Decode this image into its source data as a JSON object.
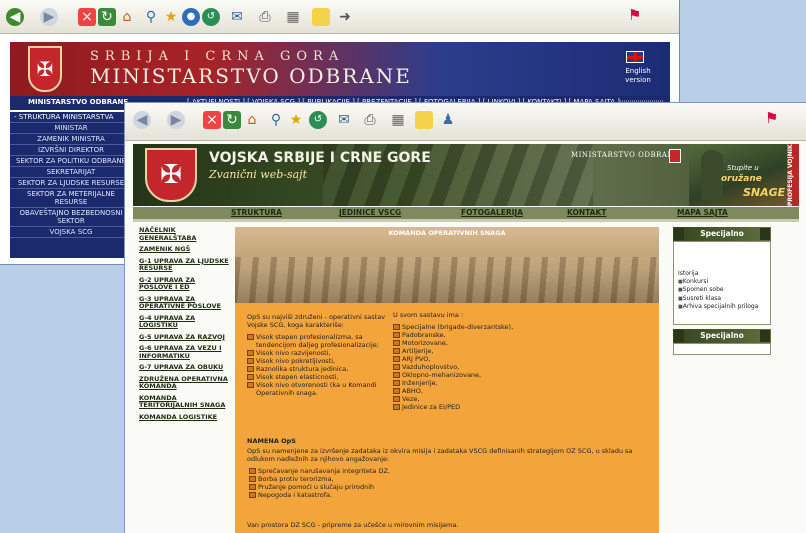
{
  "back_window": {
    "toolbar_icons": [
      "back-icon",
      "forward-icon",
      "stop-icon",
      "refresh-icon",
      "home-icon",
      "search-icon",
      "favorites-icon",
      "media-icon",
      "history-icon",
      "mail-icon",
      "print-icon",
      "edit-icon",
      "folder-icon",
      "messenger-icon"
    ],
    "banner": {
      "line1": "SRBIJA I CRNA GORA",
      "line2": "MINISTARSTVO ODBRANE",
      "english_link": "English version"
    },
    "label_bar": {
      "left": "MINISTARSTVO ODBRANE",
      "links": "[ AKTUELNOSTI ] [ VOJSKA SCG ] [ PUBLIKACIJE ] [ PREZENTACIJE ] [ FOTOGALERIJA ] [ LINKOVI ] [ KONTAKTI ] [ MAPA SAJTA ]"
    },
    "menu": [
      "- STRUKTURA MINISTARSTVA",
      "MINISTAR",
      "ZAMENIK MINISTRA",
      "IZVRŠNI DIREKTOR",
      "SEKTOR ZA POLITIKU ODBRANE",
      "SEKRETARIJAT",
      "SEKTOR ZA LJUDSKE RESURSE",
      "SEKTOR ZA METERIJALNE RESURSE",
      "OBAVEŠTAJNO BEZBEDNOSNI SEKTOR",
      "VOJSKA SCG"
    ]
  },
  "front_window": {
    "header": {
      "title": "VOJSKA SRBIJE I CRNE GORE",
      "subtitle": "Zvanični web-sajt",
      "ministry": "MINISTARSTVO ODBRANE",
      "promo": {
        "line1": "Stupite u",
        "line2": "oružane",
        "line3": "SNAGE",
        "vertical": "PROFESIJA VOJNIK"
      }
    },
    "nav": [
      "STRUKTURA",
      "JEDINICE VSCG",
      "FOTOGALERIJA",
      "KONTAKT",
      "MAPA SAJTA"
    ],
    "left_links": [
      "NAČELNIK GENERALŠTABA",
      "ZAMENIK NGŠ",
      "G-1 UPRAVA ZA LJUDSKE RESURSE",
      "G-2 UPRAVA ZA POSLOVE I ED",
      "G-3 UPRAVA ZA OPERATIVNE POSLOVE",
      "G-4 UPRAVA ZA LOGISTIKU",
      "G-5 UPRAVA ZA RAZVOJ",
      "G-6 UPRAVA ZA VEZU I INFORMATIKU",
      "G-7 UPRAVA ZA OBUKU",
      "ZDRUŽENA OPERATIVNA KOMANDA",
      "KOMANDA TERITORIJALNIH SNAGA",
      "KOMANDA LOGISTIKE"
    ],
    "main": {
      "photo_caption": "KOMANDA OPERATIVNIH SNAGA",
      "col1_intro": "OpS su najviši združeni - operativni sastav Vojske SCG, koga karakteriše:",
      "col1_items": [
        "Visok stepen profesionalizma, sa tendencijom daljeg profesionalizacije;",
        "Visok nivo razvijenosti,",
        "Visok nivo pokretljivosti,",
        "Raznolika struktura jedinica,",
        "Visok stepen elasticnosti,",
        "Visok nivo otvorenosti (ka u Komandi Operativnih snaga."
      ],
      "col2_intro": "U svom sastavu ima :",
      "col2_items": [
        "Specijalne (brigade-diverzantske),",
        "Padobranske,",
        "Motorizovane,",
        "Artiljerije,",
        "ARJ PVO,",
        "Vazduhoplovstvo,",
        "Oklopno-mehanizovane,",
        "Inženjerije,",
        "ABHO,",
        "Veze,",
        "Jedinice za EI/PED"
      ],
      "section_title": "NAMENA OpS",
      "section_text": "OpS su namenjene za izvršenje zadataka iz okvira misija i zadataka VSCG definisanih strategijom OZ SCG, u skladu sa odlukom nadležnih za njihovo angažovanje:",
      "section_items": [
        "Sprečavanje narušavanja integriteta DZ,",
        "Borba protiv terorizma,",
        "Pružanje pomoći u slučaju prirodnih",
        "Nepogoda i katastrofa."
      ],
      "section2": "Van prostora DZ SCG - pripreme za učešće u mirovnim misijama."
    },
    "right_panel": {
      "title1": "Specijalno",
      "items": [
        "Istorija",
        "Konkursi",
        "Spomen sobe",
        "Susreti klasa",
        "Arhiva specijalnih priloga"
      ],
      "title2": "Specijalno"
    }
  }
}
